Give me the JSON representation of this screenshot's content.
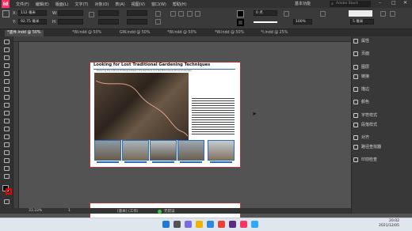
{
  "app": {
    "logo": "Id"
  },
  "menu": [
    "文件(F)",
    "编辑(E)",
    "版面(L)",
    "文字(T)",
    "对象(O)",
    "表(A)",
    "视图(V)",
    "窗口(W)",
    "帮助(H)"
  ],
  "workspace": "基本功能",
  "search": {
    "placeholder": "Adobe Stock"
  },
  "control": {
    "x_label": "X:",
    "x_value": "112 毫米",
    "y_label": "Y:",
    "y_value": "92.75 毫米",
    "w_label": "W:",
    "h_label": "H:",
    "stroke_weight": "0 点",
    "opacity": "100%",
    "spacing": "5 毫米"
  },
  "tabs": [
    {
      "label": "*遗件.indd @ 50%",
      "active": true
    },
    {
      "label": "*W.indd @ 50%",
      "active": false
    },
    {
      "label": "GW.indd @ 50%",
      "active": false
    },
    {
      "label": "*W.indd @ 50%",
      "active": false
    },
    {
      "label": "*W.indd @ 50%",
      "active": false
    },
    {
      "label": "*I.indd @ 25%",
      "active": false
    }
  ],
  "document": {
    "title": "Looking for Lost Traditional Gardening Techniques",
    "subtitle": "Exploring the Cultural Heritage between the Red Rock and the Picturesque stone Landscape"
  },
  "panels": [
    {
      "label": "属性",
      "icon": "properties-icon"
    },
    {
      "label": "页面",
      "icon": "pages-icon"
    },
    {
      "label": "图层",
      "icon": "layers-icon"
    },
    {
      "label": "链接",
      "icon": "links-icon"
    },
    {
      "label": "描边",
      "icon": "stroke-icon"
    },
    {
      "label": "颜色",
      "icon": "color-icon"
    },
    {
      "label": "字符样式",
      "icon": "character-styles-icon"
    },
    {
      "label": "段落样式",
      "icon": "paragraph-styles-icon"
    },
    {
      "label": "对齐",
      "icon": "align-icon"
    },
    {
      "label": "路径查找器",
      "icon": "pathfinder-icon"
    },
    {
      "label": "印前检查",
      "icon": "preflight-icon"
    }
  ],
  "status": {
    "zoom": "33.33%",
    "page": "1",
    "mode": "[基本] (工作)",
    "errors": "无错误"
  },
  "clock": {
    "time": "20:02",
    "date": "2021/12/05"
  },
  "colors": {
    "accent": "#ff3366",
    "frame": "#2e6bb8",
    "page_edge": "#bb3333"
  }
}
